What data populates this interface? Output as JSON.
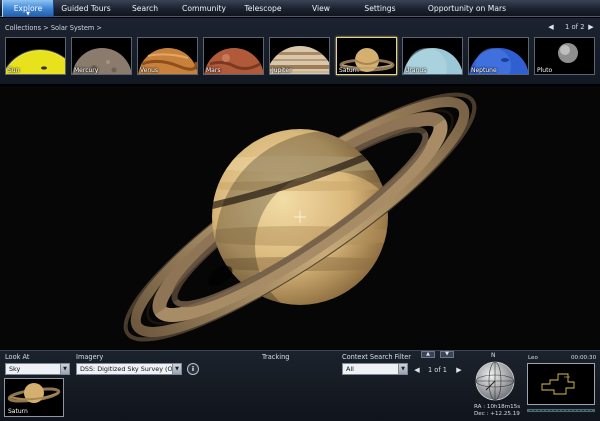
{
  "nav": {
    "tabs": [
      {
        "label": "Explore",
        "active": true
      },
      {
        "label": "Guided Tours"
      },
      {
        "label": "Search"
      },
      {
        "label": "Community"
      },
      {
        "label": "Telescope"
      },
      {
        "label": "View"
      },
      {
        "label": "Settings"
      },
      {
        "label": "Opportunity on Mars"
      }
    ]
  },
  "collections": {
    "breadcrumb": [
      "Collections",
      ">",
      "Solar System",
      ">"
    ],
    "page_indicator": "1 of 2",
    "prev_icon": "left-arrow-icon",
    "next_icon": "right-arrow-icon",
    "items": [
      {
        "name": "Sun",
        "color": "#e6e21a"
      },
      {
        "name": "Mercury",
        "color": "#8a7b6c"
      },
      {
        "name": "Venus",
        "color": "#c8813a"
      },
      {
        "name": "Mars",
        "color": "#b05a3a"
      },
      {
        "name": "Jupiter",
        "color": "#c9b79c"
      },
      {
        "name": "Saturn",
        "color": "#c9a45f",
        "selected": true
      },
      {
        "name": "Uranus",
        "color": "#9cc7d6"
      },
      {
        "name": "Neptune",
        "color": "#2f5fd0"
      },
      {
        "name": "Pluto",
        "color": "#9a9a9a"
      }
    ],
    "collapse_icon": "chevron-down-icon"
  },
  "sky": {
    "object": "Saturn",
    "crosshair_icon": "crosshair-icon"
  },
  "panel": {
    "look_at": {
      "label": "Look At",
      "value": "Sky"
    },
    "imagery": {
      "label": "Imagery",
      "value": "DSS: Digitized Sky Survey (O..."
    },
    "info_glyph": "i",
    "tracking": {
      "label": "Tracking"
    },
    "context_filter": {
      "label": "Context Search Filter",
      "value": "All"
    },
    "result_pager": "1 of 1",
    "context_result": {
      "name": "Saturn"
    },
    "compass": {
      "north_label": "N"
    },
    "ra_line": "RA :  10h18m15s",
    "dec_line": "Dec :  +12.25.19",
    "minimap": {
      "title": "Leo",
      "time": "00:00:30"
    }
  },
  "colors": {
    "accent": "#3a7fd0",
    "selected_border": "#e8d48a",
    "saturn_body": "#d9b77a"
  }
}
